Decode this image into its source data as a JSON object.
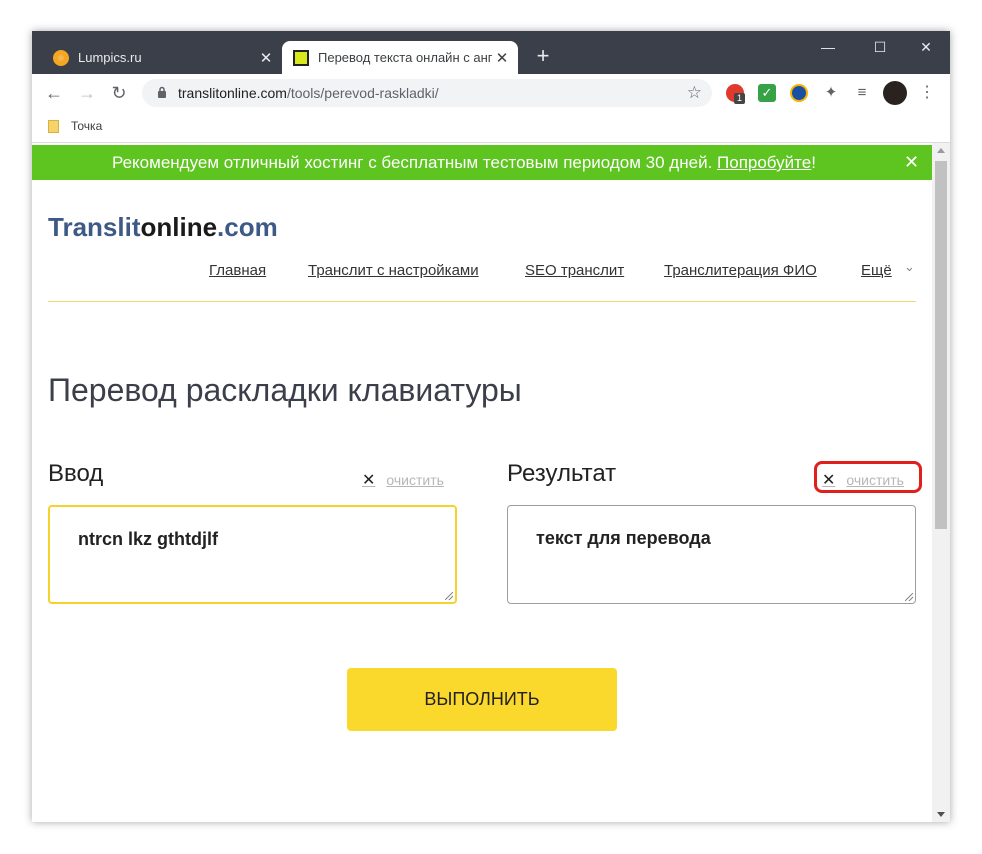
{
  "browser": {
    "tabs": [
      {
        "title": "Lumpics.ru",
        "close": "✕"
      },
      {
        "title": "Перевод текста онлайн с англи",
        "close": "✕"
      }
    ],
    "new_tab": "+",
    "window": {
      "minimize": "—",
      "maximize": "☐",
      "close": "✕"
    },
    "nav": {
      "back": "←",
      "forward": "→",
      "reload": "↻"
    },
    "url_host": "translitonline.com",
    "url_path": "/tools/perevod-raskladki/",
    "bookmark_star": "☆",
    "extensions": {
      "opera_badge": "1",
      "check": "✓",
      "puzzle": "✦",
      "playlist": "≡",
      "menu": "⋮"
    },
    "bookmark": {
      "label": "Точка"
    }
  },
  "promo": {
    "text": "Рекомендуем отличный хостинг с бесплатным тестовым периодом 30 дней. ",
    "link": "Попробуйте",
    "suffix": "!",
    "close": "✕"
  },
  "logo": {
    "part1": "Translit",
    "part2": "online",
    "part3": ".com"
  },
  "nav_menu": [
    {
      "label": "Главная"
    },
    {
      "label": "Транслит с настройками"
    },
    {
      "label": "SEO транслит"
    },
    {
      "label": "Транслитерация ФИО"
    },
    {
      "label": "Ещё"
    }
  ],
  "nav_more_chevron": "⌄",
  "page_title": "Перевод раскладки клавиатуры",
  "input_panel": {
    "label": "Ввод",
    "clear_icon": "✕",
    "clear_label": "очистить",
    "value": "ntrcn lkz gthtdjlf"
  },
  "result_panel": {
    "label": "Результат",
    "clear_icon": "✕",
    "clear_label": "очистить",
    "value": "текст для перевода"
  },
  "run_button": "ВЫПОЛНИТЬ",
  "colors": {
    "promo_bg": "#5ec41f",
    "accent_yellow": "#fbd92c",
    "highlight_red": "#e0201d",
    "logo_blue": "#3d5a86"
  }
}
